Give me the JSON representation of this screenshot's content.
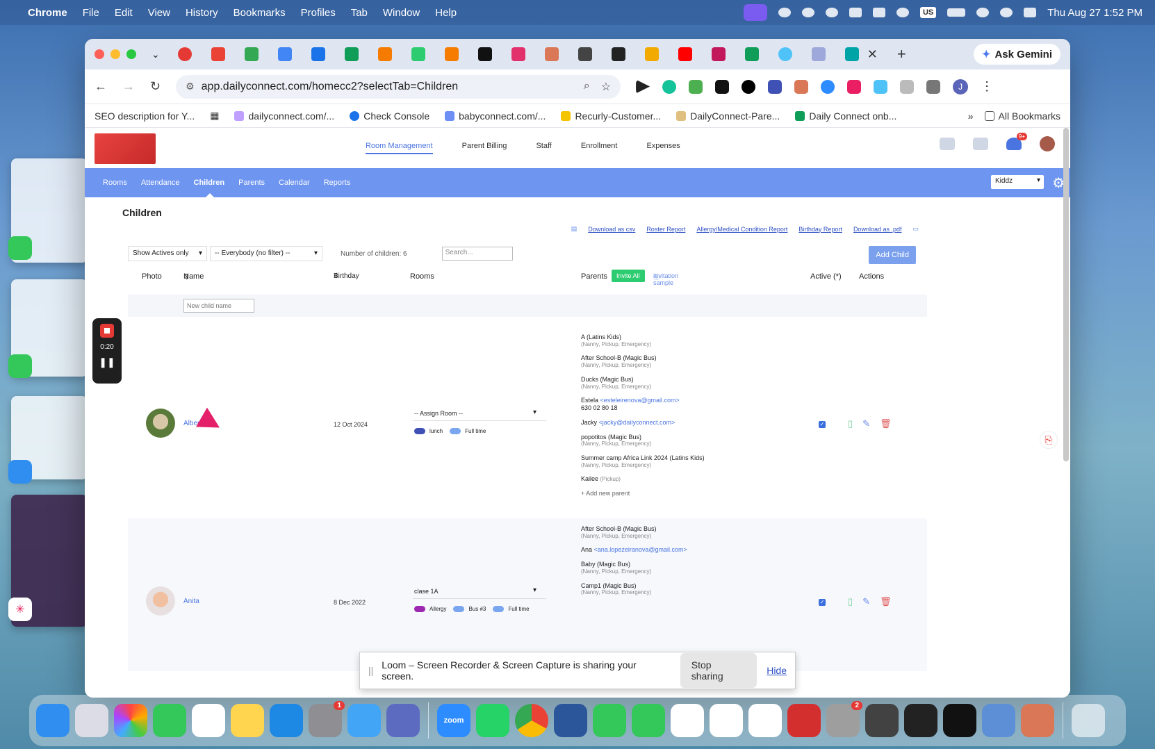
{
  "menubar": {
    "app": "Chrome",
    "items": [
      "File",
      "Edit",
      "View",
      "History",
      "Bookmarks",
      "Profiles",
      "Tab",
      "Window",
      "Help"
    ],
    "input_source": "US",
    "clock": "Thu Aug 27  1:52 PM"
  },
  "browser": {
    "ask_gemini": "Ask Gemini",
    "url": "app.dailyconnect.com/homecc2?selectTab=Children",
    "avatar_letter": "J",
    "bookmarks": [
      "SEO description for Y...",
      "dailyconnect.com/...",
      "Check Console",
      "babyconnect.com/...",
      "Recurly-Customer...",
      "DailyConnect-Pare...",
      "Daily Connect onb..."
    ],
    "all_bookmarks": "All Bookmarks"
  },
  "app": {
    "main_nav": [
      "Room Management",
      "Parent Billing",
      "Staff",
      "Enrollment",
      "Expenses"
    ],
    "notification_count": "9+",
    "sub_nav": [
      "Rooms",
      "Attendance",
      "Children",
      "Parents",
      "Calendar",
      "Reports"
    ],
    "school": "Kiddz"
  },
  "children": {
    "title": "Children",
    "reports": [
      "Download as csv",
      "Roster Report",
      "Allergy/Medical Condition Report",
      "Birthday Report",
      "Download as .pdf"
    ],
    "filter_active": "Show Actives only",
    "filter_group": "-- Everybody (no filter) --",
    "count": "Number of children: 6",
    "search_placeholder": "Search...",
    "add_child": "Add Child",
    "headers": {
      "photo": "Photo",
      "name": "Name",
      "birthday": "Birthday",
      "rooms": "Rooms",
      "parents": "Parents",
      "invite_all": "Invite All",
      "invitation_sample": "Invitation sample",
      "active": "Active (*)",
      "actions": "Actions"
    },
    "new_child_placeholder": "New child name",
    "rows": [
      {
        "name": "Albert",
        "birthday": "12 Oct 2024",
        "room": "-- Assign Room --",
        "tags": [
          "lunch",
          "Full time"
        ],
        "parents": [
          {
            "name": "A (Latins Kids)",
            "sub": "(Nanny, Pickup, Emergency)"
          },
          {
            "name": "After School-B (Magic Bus)",
            "sub": "(Nanny, Pickup, Emergency)"
          },
          {
            "name": "Ducks (Magic Bus)",
            "sub": "(Nanny, Pickup, Emergency)"
          },
          {
            "name": "Estela",
            "email": "<esteleirenova@gmail.com>",
            "sub": "630 02 80 18"
          },
          {
            "name": "Jacky",
            "email": "<jacky@dailyconnect.com>",
            "sub": ""
          },
          {
            "name": "popotitos (Magic Bus)",
            "sub": "(Nanny, Pickup, Emergency)"
          },
          {
            "name": "Summer camp Africa Link 2024 (Latins Kids)",
            "sub": "(Nanny, Pickup, Emergency)"
          },
          {
            "name": "Kailee",
            "sub": "(Pickup)"
          }
        ],
        "add_parent": "+ Add new parent"
      },
      {
        "name": "Anita",
        "birthday": "8 Dec 2022",
        "room": "clase 1A",
        "tags": [
          "Allergy",
          "Bus #3",
          "Full time"
        ],
        "parents": [
          {
            "name": "After School-B (Magic Bus)",
            "sub": "(Nanny, Pickup, Emergency)"
          },
          {
            "name": "Ana",
            "email": "<ana.lopezeiranova@gmail.com>",
            "sub": ""
          },
          {
            "name": "Baby (Magic Bus)",
            "sub": "(Nanny, Pickup, Emergency)"
          },
          {
            "name": "Camp1 (Magic Bus)",
            "sub": "(Nanny, Pickup, Emergency)"
          }
        ]
      }
    ]
  },
  "loom": {
    "timer": "0:20",
    "share_text": "Loom – Screen Recorder & Screen Capture is sharing your screen.",
    "stop_sharing": "Stop sharing",
    "hide": "Hide"
  },
  "dock": {
    "zoom_label": "zoom",
    "badges": [
      "1",
      "2"
    ]
  },
  "colors": {
    "accent": "#4a74e0",
    "subnav": "#6e95f0",
    "invite": "#2ecc71",
    "danger": "#e05a5a"
  }
}
